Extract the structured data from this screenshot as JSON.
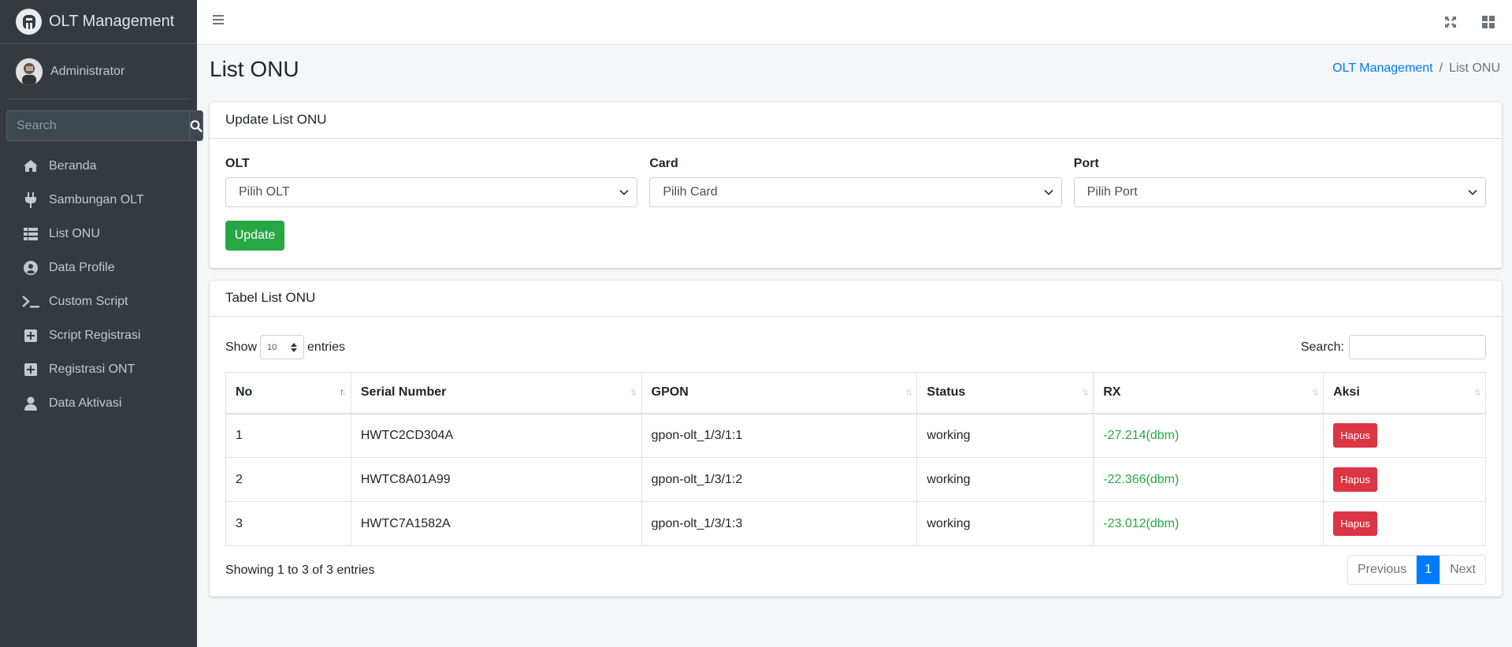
{
  "brand": {
    "title": "OLT Management"
  },
  "user": {
    "name": "Administrator"
  },
  "sidebar": {
    "search_placeholder": "Search",
    "items": [
      {
        "label": "Beranda",
        "icon": "home-icon"
      },
      {
        "label": "Sambungan OLT",
        "icon": "plug-icon"
      },
      {
        "label": "List ONU",
        "icon": "table-list-icon"
      },
      {
        "label": "Data Profile",
        "icon": "user-circle-icon"
      },
      {
        "label": "Custom Script",
        "icon": "terminal-icon"
      },
      {
        "label": "Script Registrasi",
        "icon": "plus-square-icon"
      },
      {
        "label": "Registrasi ONT",
        "icon": "plus-square-icon"
      },
      {
        "label": "Data Aktivasi",
        "icon": "user-icon"
      }
    ]
  },
  "page": {
    "title": "List ONU",
    "breadcrumb": {
      "home": "OLT Management",
      "separator": "/",
      "current": "List ONU"
    }
  },
  "update_card": {
    "title": "Update List ONU",
    "olt": {
      "label": "OLT",
      "value": "Pilih OLT"
    },
    "card": {
      "label": "Card",
      "value": "Pilih Card"
    },
    "port": {
      "label": "Port",
      "value": "Pilih Port"
    },
    "button": "Update"
  },
  "table_card": {
    "title": "Tabel List ONU",
    "show_label": "Show",
    "length_value": "10",
    "entries_label": "entries",
    "search_label": "Search:",
    "columns": [
      "No",
      "Serial Number",
      "GPON",
      "Status",
      "RX",
      "Aksi"
    ],
    "rows": [
      {
        "no": "1",
        "serial": "HWTC2CD304A",
        "gpon": "gpon-olt_1/3/1:1",
        "status": "working",
        "rx": "-27.214(dbm)",
        "action": "Hapus"
      },
      {
        "no": "2",
        "serial": "HWTC8A01A99",
        "gpon": "gpon-olt_1/3/1:2",
        "status": "working",
        "rx": "-22.366(dbm)",
        "action": "Hapus"
      },
      {
        "no": "3",
        "serial": "HWTC7A1582A",
        "gpon": "gpon-olt_1/3/1:3",
        "status": "working",
        "rx": "-23.012(dbm)",
        "action": "Hapus"
      }
    ],
    "info": "Showing 1 to 3 of 3 entries",
    "pager": {
      "previous": "Previous",
      "page": "1",
      "next": "Next"
    }
  },
  "colors": {
    "sidebar": "#343a40",
    "primary": "#007bff",
    "success": "#28a745",
    "danger": "#dc3545"
  }
}
